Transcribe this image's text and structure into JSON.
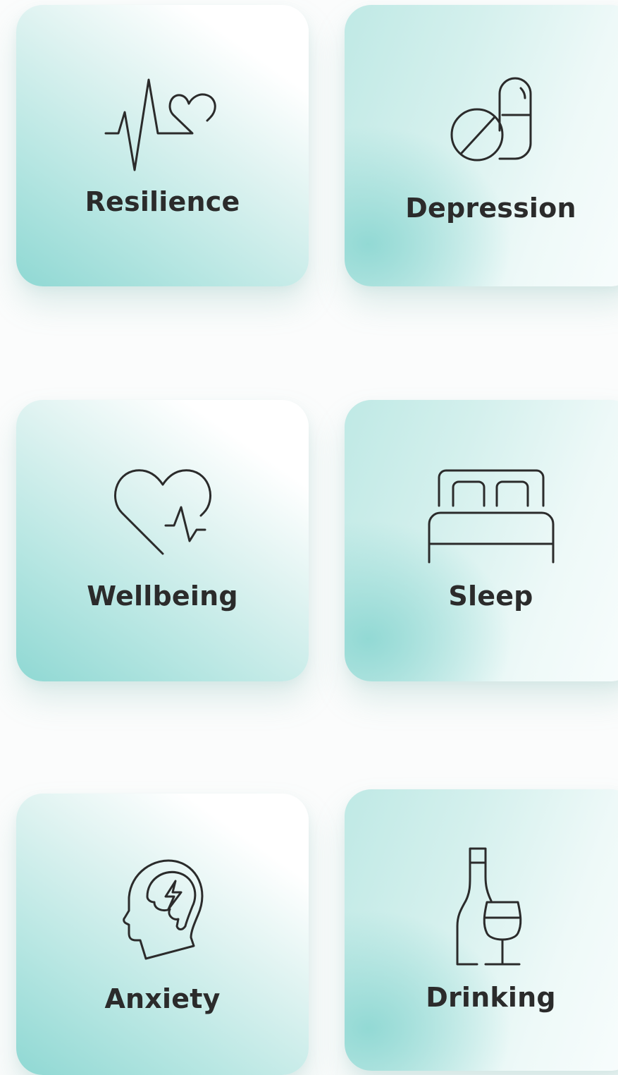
{
  "categories": [
    {
      "label": "Resilience",
      "icon": "heartbeat-heart-icon"
    },
    {
      "label": "Depression",
      "icon": "pill-capsule-icon"
    },
    {
      "label": "Wellbeing",
      "icon": "heart-pulse-icon"
    },
    {
      "label": "Sleep",
      "icon": "bed-icon"
    },
    {
      "label": "Anxiety",
      "icon": "head-brain-lightning-icon"
    },
    {
      "label": "Drinking",
      "icon": "bottle-wine-glass-icon"
    }
  ],
  "colors": {
    "card_teal": "#8fd8d3",
    "card_light": "#ffffff",
    "text": "#2b2b2b",
    "page_background": "#fbfcfc"
  }
}
